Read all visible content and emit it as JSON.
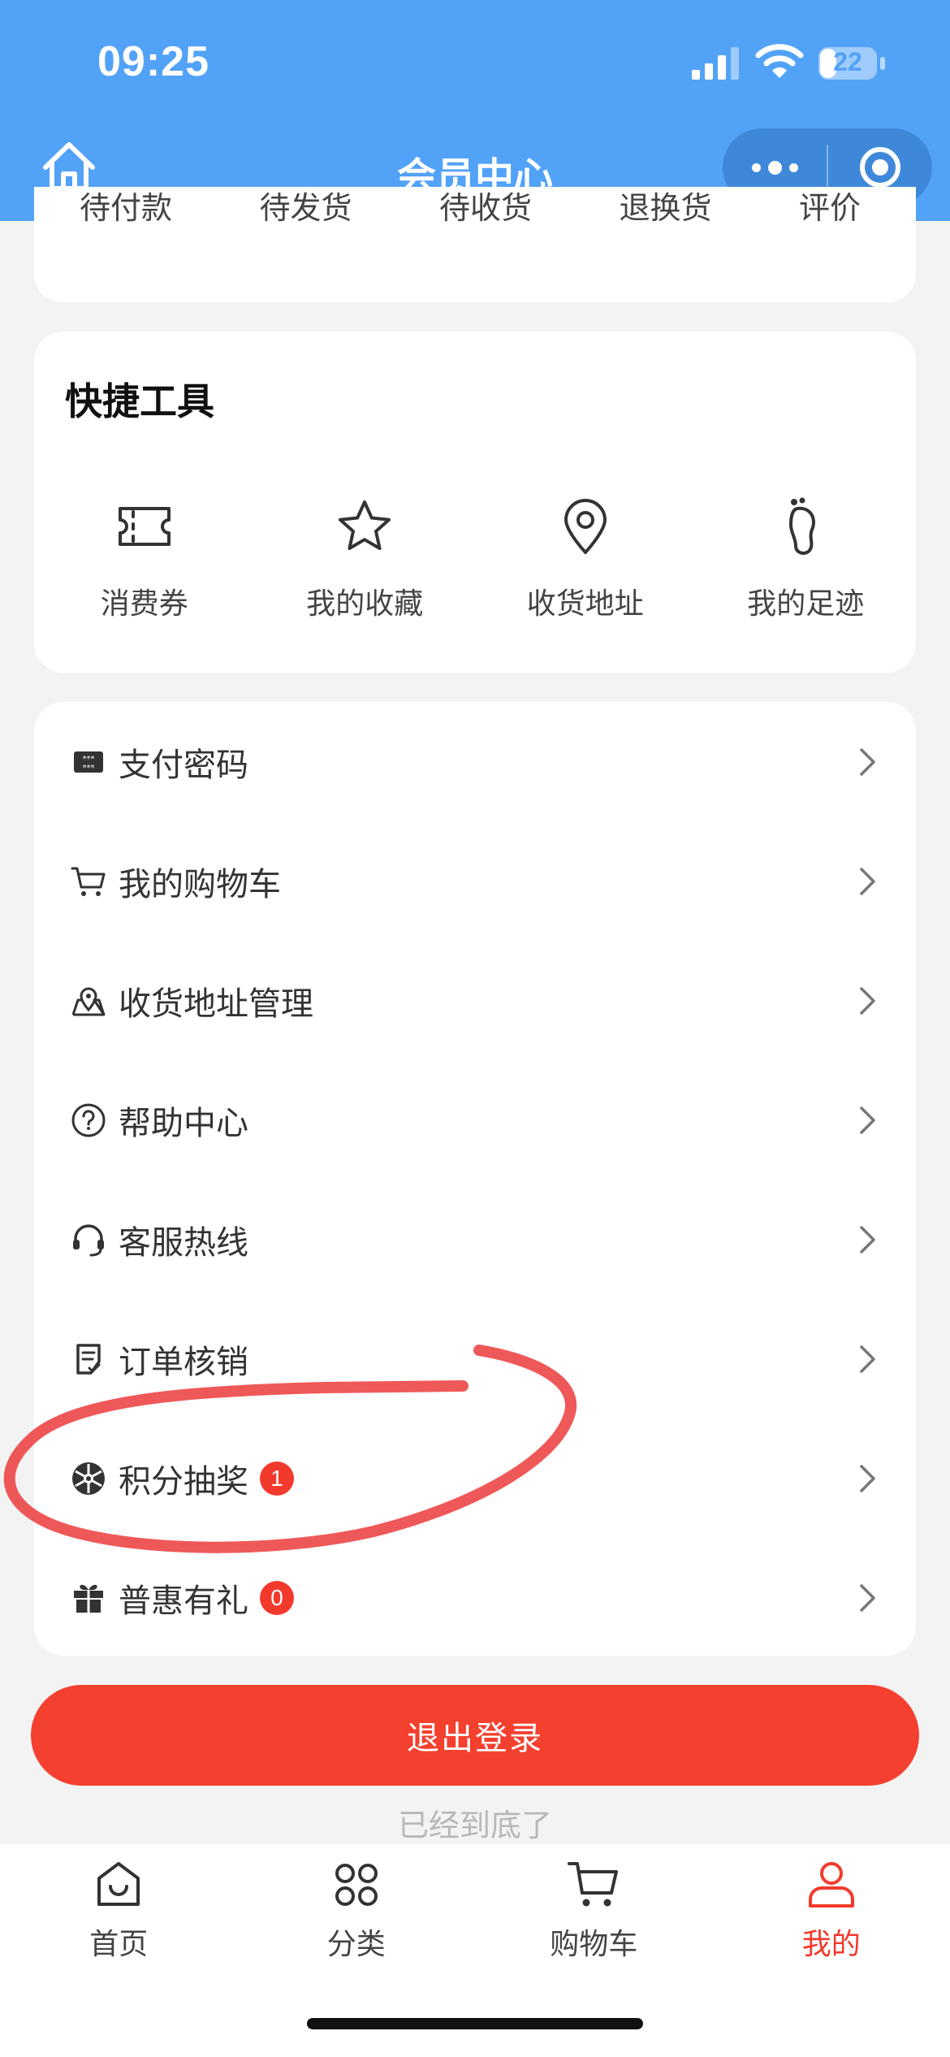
{
  "status_bar": {
    "time": "09:25",
    "battery": "22"
  },
  "nav": {
    "title": "会员中心"
  },
  "orders": {
    "tabs": [
      "待付款",
      "待发货",
      "待收货",
      "退换货",
      "评价"
    ]
  },
  "tools": {
    "title": "快捷工具",
    "items": [
      {
        "label": "消费券",
        "icon": "ticket-icon"
      },
      {
        "label": "我的收藏",
        "icon": "star-icon"
      },
      {
        "label": "收货地址",
        "icon": "location-pin-icon"
      },
      {
        "label": "我的足迹",
        "icon": "footprint-icon"
      }
    ]
  },
  "menu": {
    "items": [
      {
        "label": "支付密码",
        "icon": "keypad-icon"
      },
      {
        "label": "我的购物车",
        "icon": "cart-icon"
      },
      {
        "label": "收货地址管理",
        "icon": "map-pin-icon"
      },
      {
        "label": "帮助中心",
        "icon": "help-icon"
      },
      {
        "label": "客服热线",
        "icon": "headset-icon"
      },
      {
        "label": "订单核销",
        "icon": "receipt-icon"
      },
      {
        "label": "积分抽奖",
        "icon": "lottery-wheel-icon",
        "badge": "1"
      },
      {
        "label": "普惠有礼",
        "icon": "gift-icon",
        "badge": "0"
      }
    ]
  },
  "logout": {
    "label": "退出登录"
  },
  "bottom_hint": "已经到底了",
  "tabbar": {
    "items": [
      {
        "label": "首页",
        "icon": "home-icon"
      },
      {
        "label": "分类",
        "icon": "category-icon"
      },
      {
        "label": "购物车",
        "icon": "cart-icon"
      },
      {
        "label": "我的",
        "icon": "user-icon",
        "active": true
      }
    ]
  },
  "colors": {
    "header": "#52a2f8",
    "accent": "#f4402f",
    "badge": "#f23a2c",
    "annotation": "#ee4a4a"
  }
}
